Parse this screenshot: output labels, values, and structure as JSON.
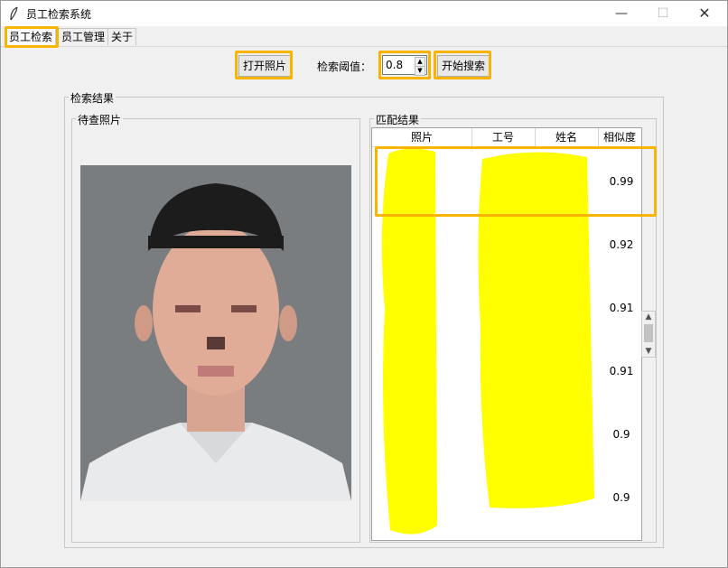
{
  "window": {
    "title": "员工检索系统",
    "min_glyph": "—",
    "max_glyph": "☐",
    "close_glyph": "✕"
  },
  "tabs": [
    {
      "label": "员工检索",
      "active": true
    },
    {
      "label": "员工管理"
    },
    {
      "label": "关于"
    }
  ],
  "toolbar": {
    "open_photo_label": "打开照片",
    "threshold_label": "检索阈值：",
    "threshold_value": "0.8",
    "search_label": "开始搜索"
  },
  "results": {
    "title": "检索结果",
    "query_title": "待查照片",
    "match_title": "匹配结果",
    "columns": [
      "照片",
      "工号",
      "姓名",
      "相似度"
    ],
    "rows": [
      {
        "similarity": "0.99"
      },
      {
        "similarity": "0.92"
      },
      {
        "similarity": "0.91"
      },
      {
        "similarity": "0.91"
      },
      {
        "similarity": "0.9"
      },
      {
        "similarity": "0.9"
      }
    ]
  },
  "colors": {
    "highlight": "#f7b500",
    "redaction": "#ffff00",
    "photo_background": "#7a7d7f"
  }
}
